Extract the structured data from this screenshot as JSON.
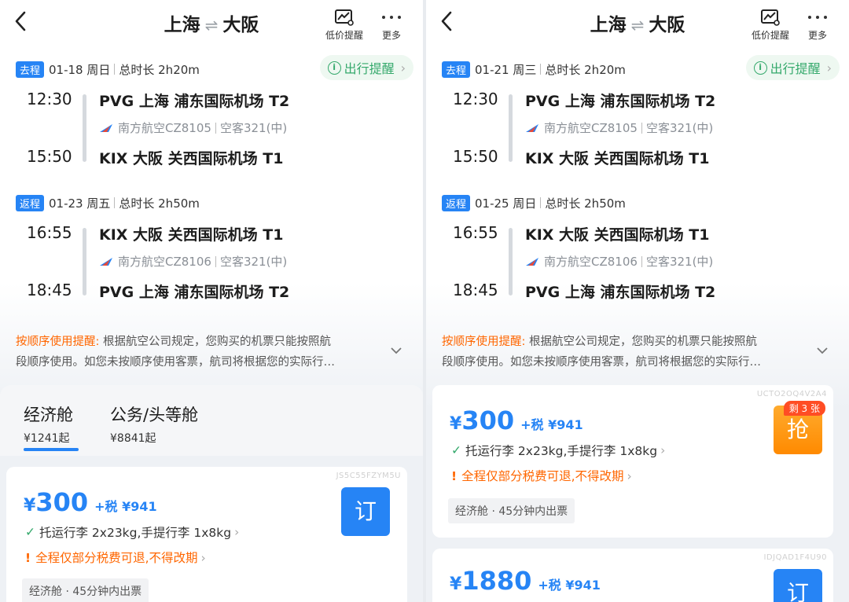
{
  "left": {
    "header": {
      "from": "上海",
      "to": "大阪",
      "price_alert_label": "低价提醒",
      "more_label": "更多"
    },
    "outbound": {
      "tag": "去程",
      "date": "01-18 周日",
      "duration": "总时长 2h20m",
      "tip_label": "出行提醒",
      "dep_time": "12:30",
      "dep_airport": "PVG 上海 浦东国际机场 T2",
      "airline": "南方航空CZ8105",
      "aircraft": "空客321(中)",
      "arr_time": "15:50",
      "arr_airport": "KIX 大阪 关西国际机场 T1"
    },
    "return": {
      "tag": "返程",
      "date": "01-23 周五",
      "duration": "总时长 2h50m",
      "dep_time": "16:55",
      "dep_airport": "KIX 大阪 关西国际机场 T1",
      "airline": "南方航空CZ8106",
      "aircraft": "空客321(中)",
      "arr_time": "18:45",
      "arr_airport": "PVG 上海 浦东国际机场 T2"
    },
    "notice": {
      "title": "按顺序使用提醒:",
      "line1": " 根据航空公司规定，您购买的机票只能按照航",
      "line2": "段顺序使用。如您未按顺序使用客票，航司将根据您的实际行…"
    },
    "cabins": [
      {
        "name": "经济舱",
        "price": "¥1241起"
      },
      {
        "name": "公务/头等舱",
        "price": "¥8841起"
      }
    ],
    "fare": {
      "code": "JS5C55FZYM5U",
      "currency": "¥",
      "amount": "300",
      "tax": "+税 ¥941",
      "baggage": "托运行李 2x23kg,手提行李 1x8kg",
      "refund": "全程仅部分税费可退,不得改期",
      "chip": "经济舱 · 45分钟内出票",
      "book": "订"
    }
  },
  "right": {
    "header": {
      "from": "上海",
      "to": "大阪",
      "price_alert_label": "低价提醒",
      "more_label": "更多"
    },
    "outbound": {
      "tag": "去程",
      "date": "01-21 周三",
      "duration": "总时长 2h20m",
      "tip_label": "出行提醒",
      "dep_time": "12:30",
      "dep_airport": "PVG 上海 浦东国际机场 T2",
      "airline": "南方航空CZ8105",
      "aircraft": "空客321(中)",
      "arr_time": "15:50",
      "arr_airport": "KIX 大阪 关西国际机场 T1"
    },
    "return": {
      "tag": "返程",
      "date": "01-25 周日",
      "duration": "总时长 2h50m",
      "dep_time": "16:55",
      "dep_airport": "KIX 大阪 关西国际机场 T1",
      "airline": "南方航空CZ8106",
      "aircraft": "空客321(中)",
      "arr_time": "18:45",
      "arr_airport": "PVG 上海 浦东国际机场 T2"
    },
    "notice": {
      "title": "按顺序使用提醒:",
      "line1": " 根据航空公司规定，您购买的机票只能按照航",
      "line2": "段顺序使用。如您未按顺序使用客票，航司将根据您的实际行…"
    },
    "fare1": {
      "code": "UCTO2OQ4V2A4",
      "currency": "¥",
      "amount": "300",
      "tax": "+税 ¥941",
      "baggage": "托运行李 2x23kg,手提行李 1x8kg",
      "refund": "全程仅部分税费可退,不得改期",
      "chip": "经济舱 · 45分钟内出票",
      "remaining": "剩 3 张",
      "book": "抢"
    },
    "fare2": {
      "code": "IDJQAD1F4U90",
      "currency": "¥",
      "amount": "1880",
      "tax": "+税 ¥941",
      "book": "订"
    }
  },
  "colors": {
    "accent": "#2684f5",
    "warning": "#ff6600",
    "success": "#35a96c",
    "grab": "#ff8a00"
  }
}
